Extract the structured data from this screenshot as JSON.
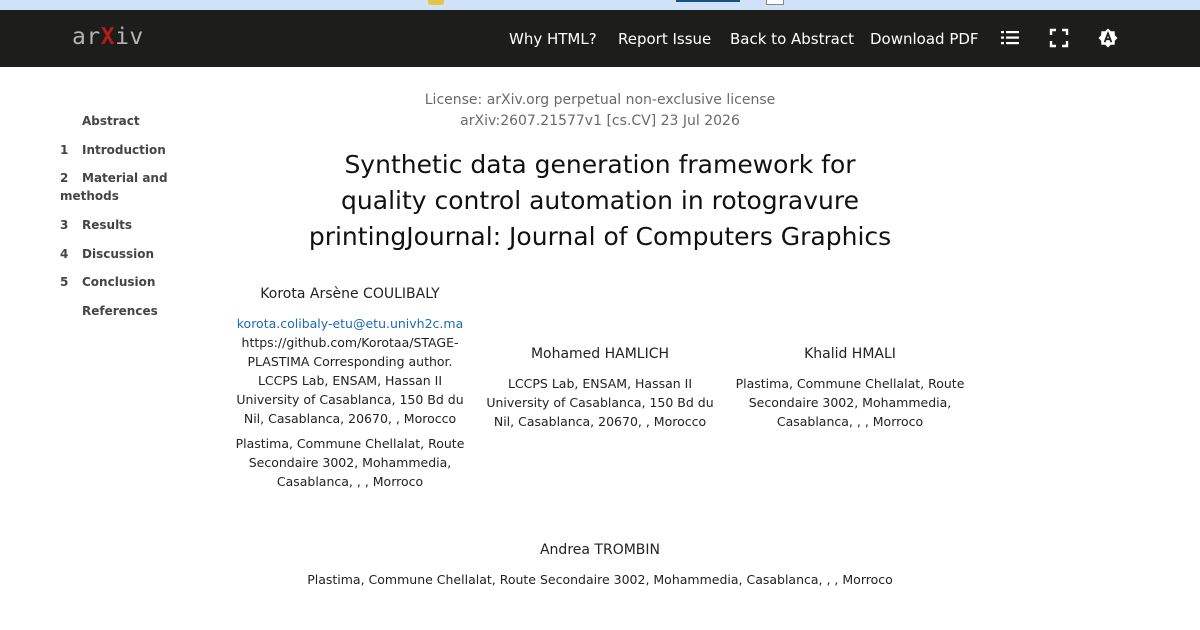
{
  "navbar": {
    "logo": {
      "left": "ar",
      "mark": "X",
      "right": "iv"
    },
    "links": [
      "Why HTML?",
      "Report Issue",
      "Back to Abstract",
      "Download PDF"
    ],
    "icons": [
      "list-icon",
      "fullscreen-icon",
      "theme-toggle-icon"
    ]
  },
  "toc": [
    {
      "num": "",
      "label": "Abstract"
    },
    {
      "num": "1",
      "label": "Introduction"
    },
    {
      "num": "2",
      "label": "Material and methods"
    },
    {
      "num": "3",
      "label": "Results"
    },
    {
      "num": "4",
      "label": "Discussion"
    },
    {
      "num": "5",
      "label": "Conclusion"
    },
    {
      "num": "",
      "label": "References"
    }
  ],
  "paper": {
    "license": "License: arXiv.org perpetual non-exclusive license",
    "arxiv_id": "arXiv:2607.21577v1 [cs.CV] 23 Jul 2026",
    "title_lines": [
      "Synthetic data generation framework for",
      "quality control automation in rotogravure",
      "printingJournal: Journal of Computers Graphics"
    ]
  },
  "authors": [
    {
      "name": "Korota Arsène COULIBALY",
      "email": "korota.colibaly-etu@etu.univh2c.ma",
      "lines": [
        "https://github.com/Korotaa/STAGE-",
        "PLASTIMA Corresponding author.",
        "LCCPS Lab, ENSAM, Hassan II",
        "University of Casablanca, 150 Bd du",
        "Nil, Casablanca, 20670, , Morocco"
      ],
      "affil2": [
        "Plastima, Commune Chellalat, Route",
        "Secondaire 3002, Mohammedia,",
        "Casablanca, , , Morroco"
      ]
    },
    {
      "name": "Mohamed HAMLICH",
      "lines": [
        "LCCPS Lab, ENSAM, Hassan II",
        "University of Casablanca, 150 Bd du",
        "Nil, Casablanca, 20670, , Morocco"
      ]
    },
    {
      "name": "Khalid HMALI",
      "lines": [
        "Plastima, Commune Chellalat, Route",
        "Secondaire 3002, Mohammedia,",
        "Casablanca, , , Morroco"
      ]
    },
    {
      "name": "Andrea TROMBIN",
      "lines": [
        "Plastima, Commune Chellalat, Route Secondaire 3002, Mohammedia, Casablanca, , , Morroco"
      ]
    }
  ]
}
